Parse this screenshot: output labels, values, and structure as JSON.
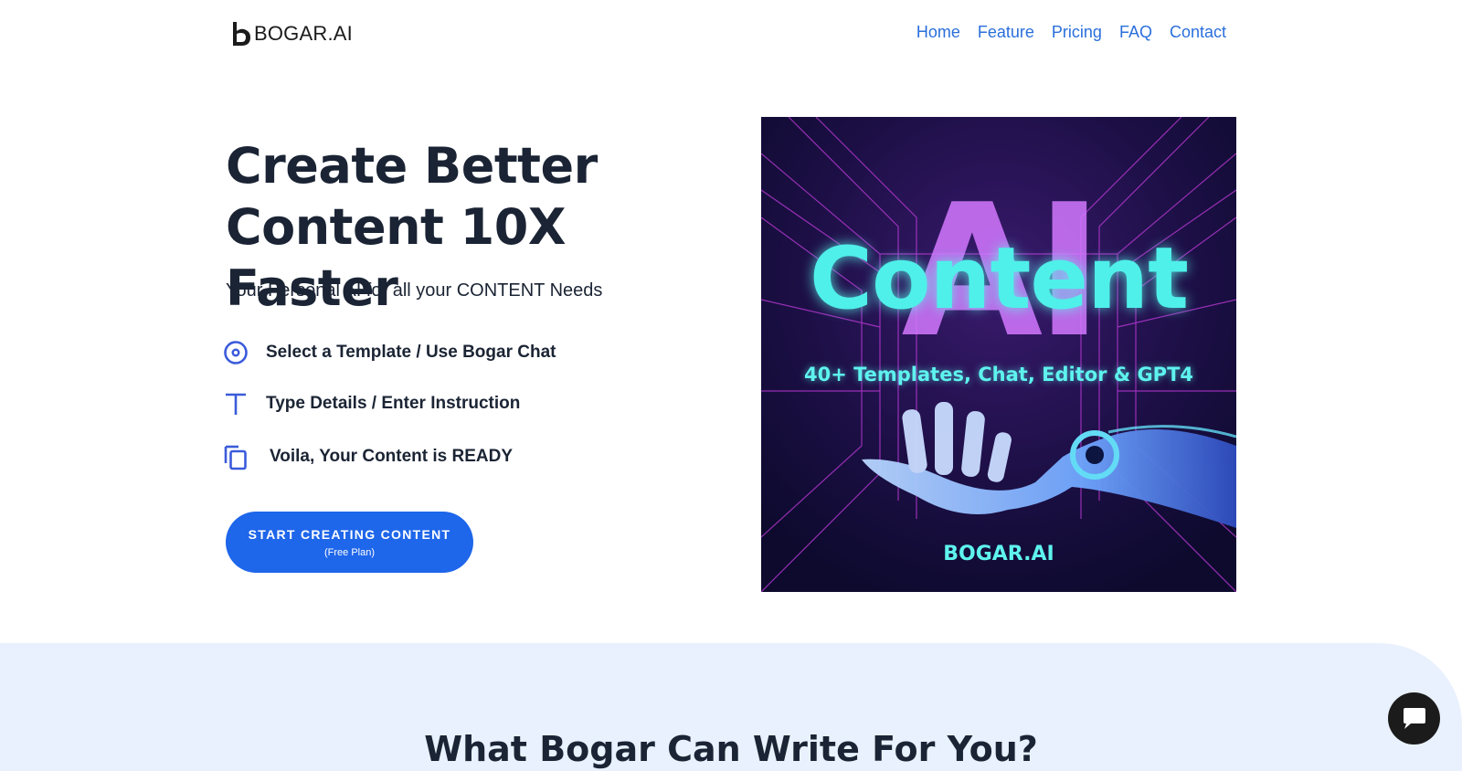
{
  "header": {
    "brand": "BOGAR.AI",
    "nav": [
      {
        "label": "Home"
      },
      {
        "label": "Feature"
      },
      {
        "label": "Pricing"
      },
      {
        "label": "FAQ"
      },
      {
        "label": "Contact"
      }
    ]
  },
  "hero": {
    "title_line1": "Create Better",
    "title_line2": "Content 10X Faster",
    "subtitle": "Your Personal AI for all your CONTENT Needs",
    "steps": [
      {
        "icon": "target-icon",
        "label": "Select a Template / Use Bogar Chat"
      },
      {
        "icon": "text-icon",
        "label": "Type Details / Enter Instruction"
      },
      {
        "icon": "copy-icon",
        "label": "Voila, Your Content is READY"
      }
    ],
    "cta": {
      "label": "START CREATING CONTENT",
      "sublabel": "(Free Plan)"
    },
    "image": {
      "big_text": "AI",
      "headline": "Content",
      "tagline": "40+ Templates, Chat, Editor & GPT4",
      "brand": "BOGAR.AI"
    }
  },
  "section2": {
    "title": "What Bogar Can Write For You?"
  },
  "chat_widget": {
    "icon": "chat-bubble-icon"
  },
  "colors": {
    "accent": "#1e66ea",
    "nav_link": "#2a6fdb",
    "heading": "#1b2434",
    "section_bg": "#e8f1fd",
    "neon": "#4ff0e9"
  }
}
